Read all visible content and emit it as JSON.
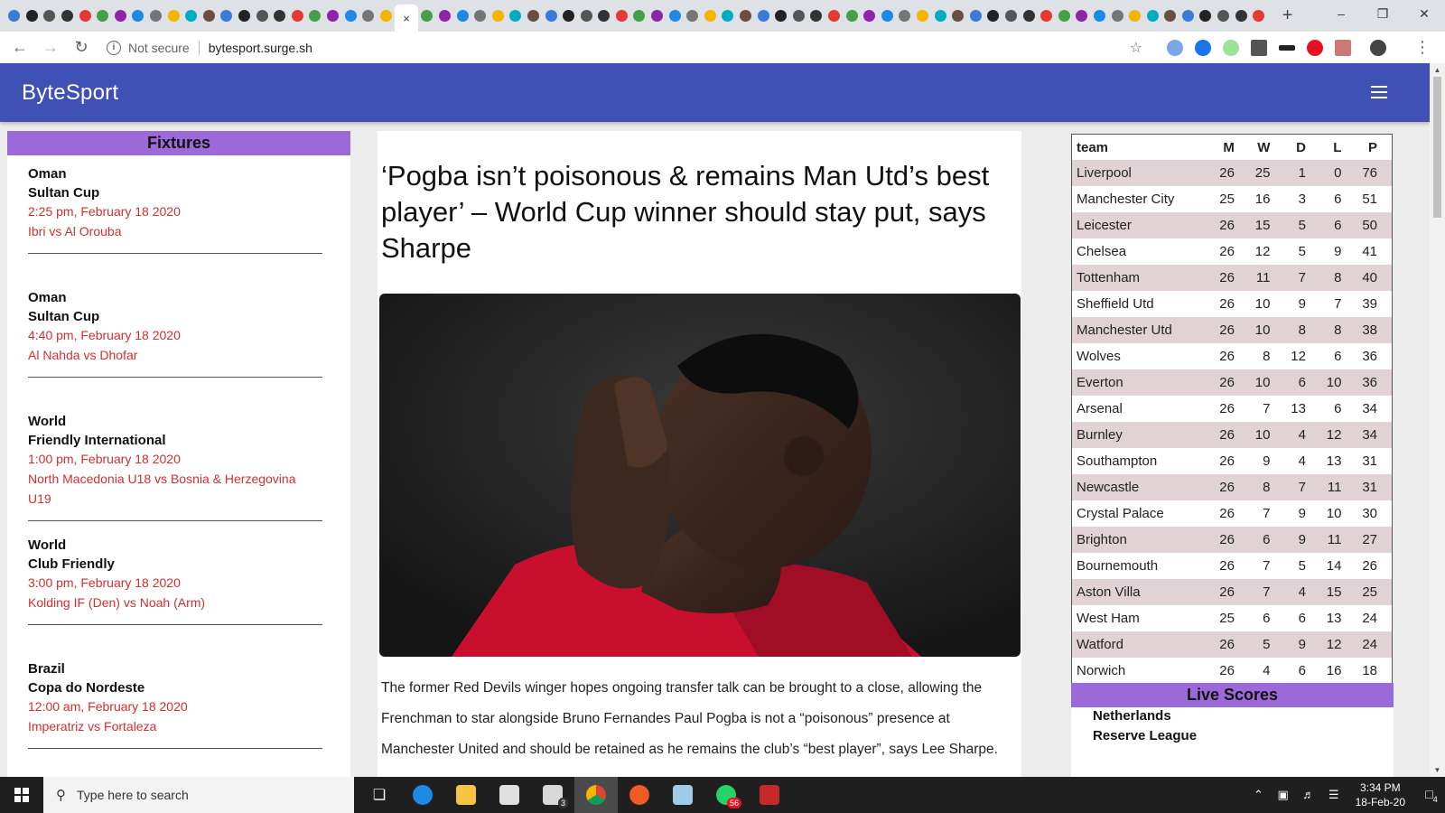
{
  "browser": {
    "url_security": "Not secure",
    "url": "bytesport.surge.sh",
    "active_tab_close": "×"
  },
  "site": {
    "brand": "ByteSport"
  },
  "fixtures": {
    "title": "Fixtures",
    "items": [
      {
        "country": "Oman",
        "league": "Sultan Cup",
        "time": "2:25 pm, February 18 2020",
        "teams": "Ibri vs Al Orouba"
      },
      {
        "country": "Oman",
        "league": "Sultan Cup",
        "time": "4:40 pm, February 18 2020",
        "teams": "Al Nahda vs Dhofar"
      },
      {
        "country": "World",
        "league": "Friendly International",
        "time": "1:00 pm, February 18 2020",
        "teams": "North Macedonia U18 vs Bosnia & Herzegovina U19"
      },
      {
        "country": "World",
        "league": "Club Friendly",
        "time": "3:00 pm, February 18 2020",
        "teams": "Kolding IF (Den) vs Noah (Arm)"
      },
      {
        "country": "Brazil",
        "league": "Copa do Nordeste",
        "time": "12:00 am, February 18 2020",
        "teams": "Imperatriz vs Fortaleza"
      }
    ]
  },
  "article": {
    "title": "‘Pogba isn’t poisonous & remains Man Utd’s best player’ – World Cup winner should stay put, says Sharpe",
    "body": "The former Red Devils winger hopes ongoing transfer talk can be brought to a close, allowing the Frenchman to star alongside Bruno Fernandes Paul Pogba is not a “poisonous” presence at Manchester United and should be retained as he remains the club’s “best player”, says Lee Sharpe."
  },
  "standings": {
    "headers": [
      "team",
      "M",
      "W",
      "D",
      "L",
      "P"
    ],
    "rows": [
      [
        "Liverpool",
        "26",
        "25",
        "1",
        "0",
        "76"
      ],
      [
        "Manchester City",
        "25",
        "16",
        "3",
        "6",
        "51"
      ],
      [
        "Leicester",
        "26",
        "15",
        "5",
        "6",
        "50"
      ],
      [
        "Chelsea",
        "26",
        "12",
        "5",
        "9",
        "41"
      ],
      [
        "Tottenham",
        "26",
        "11",
        "7",
        "8",
        "40"
      ],
      [
        "Sheffield Utd",
        "26",
        "10",
        "9",
        "7",
        "39"
      ],
      [
        "Manchester Utd",
        "26",
        "10",
        "8",
        "8",
        "38"
      ],
      [
        "Wolves",
        "26",
        "8",
        "12",
        "6",
        "36"
      ],
      [
        "Everton",
        "26",
        "10",
        "6",
        "10",
        "36"
      ],
      [
        "Arsenal",
        "26",
        "7",
        "13",
        "6",
        "34"
      ],
      [
        "Burnley",
        "26",
        "10",
        "4",
        "12",
        "34"
      ],
      [
        "Southampton",
        "26",
        "9",
        "4",
        "13",
        "31"
      ],
      [
        "Newcastle",
        "26",
        "8",
        "7",
        "11",
        "31"
      ],
      [
        "Crystal Palace",
        "26",
        "7",
        "9",
        "10",
        "30"
      ],
      [
        "Brighton",
        "26",
        "6",
        "9",
        "11",
        "27"
      ],
      [
        "Bournemouth",
        "26",
        "7",
        "5",
        "14",
        "26"
      ],
      [
        "Aston Villa",
        "26",
        "7",
        "4",
        "15",
        "25"
      ],
      [
        "West Ham",
        "25",
        "6",
        "6",
        "13",
        "24"
      ],
      [
        "Watford",
        "26",
        "5",
        "9",
        "12",
        "24"
      ],
      [
        "Norwich",
        "26",
        "4",
        "6",
        "16",
        "18"
      ]
    ]
  },
  "live_scores": {
    "title": "Live Scores",
    "country": "Netherlands",
    "league": "Reserve League"
  },
  "taskbar": {
    "search_placeholder": "Type here to search",
    "time": "3:34 PM",
    "date": "18-Feb-20",
    "mail_badge": "3",
    "whatsapp_badge": "56",
    "notification_count": "4"
  },
  "colors": {
    "header": "#3f51b5",
    "panel_title": "#9c6ad8",
    "fixture_red": "#d32f2f",
    "row_tint": "#e1d2d6"
  }
}
